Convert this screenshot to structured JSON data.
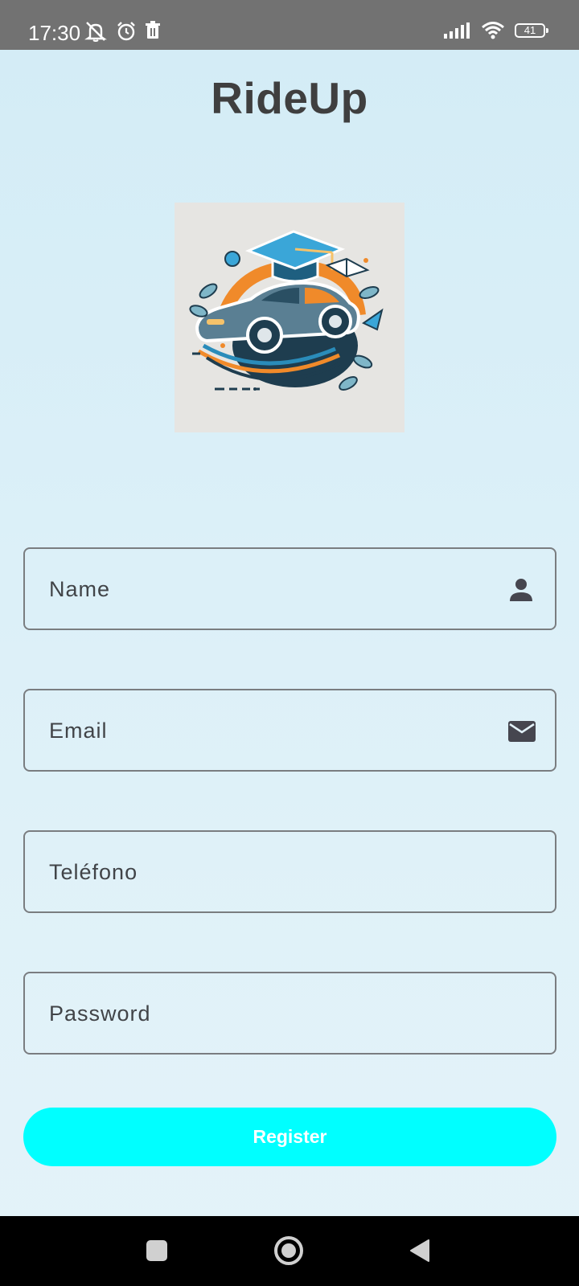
{
  "status_bar": {
    "time": "17:30",
    "battery": "41",
    "icons": [
      "mute-icon",
      "alarm-icon",
      "trash-icon",
      "signal-icon",
      "wifi-icon",
      "battery-icon"
    ]
  },
  "header": {
    "title": "RideUp"
  },
  "logo": {
    "icon": "car-graduation-cap-logo"
  },
  "form": {
    "name_label": "Name",
    "name_icon": "person-icon",
    "email_label": "Email",
    "email_icon": "mail-icon",
    "phone_label": "Teléfono",
    "password_label": "Password",
    "register_label": "Register"
  },
  "colors": {
    "accent": "#00ffff",
    "title": "#3f3f3f",
    "field_border": "#7a7d80",
    "status_bar": "#727272"
  },
  "nav_bar": {
    "buttons": [
      "recents-square-icon",
      "home-circle-icon",
      "back-triangle-icon"
    ]
  }
}
